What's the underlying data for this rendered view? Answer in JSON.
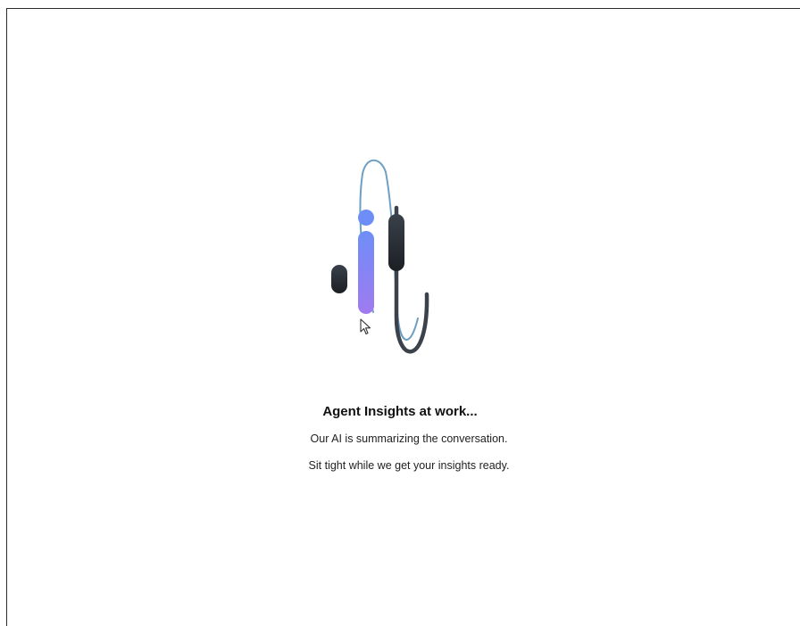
{
  "loading_panel": {
    "title": "Agent Insights at work...",
    "message_line_1": "Our AI is summarizing the conversation.",
    "message_line_2": "Sit tight while we get your insights ready."
  },
  "illustration": {
    "icon": "agent-insights-loading-icon",
    "colors": {
      "accent_top": "#6e8ef7",
      "accent_bottom": "#9a7cf0",
      "dark": "#2a2f36",
      "outline_blue": "#6d9fc4"
    }
  }
}
